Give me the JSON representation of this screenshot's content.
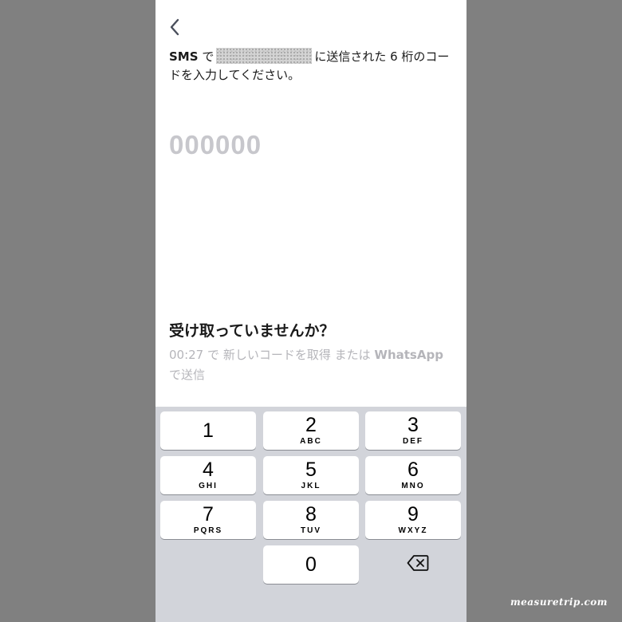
{
  "instruction": {
    "prefix": "SMS",
    "particle": "で",
    "phone_number": "",
    "suffix": "に送信された 6 桁のコードを入力してください。"
  },
  "code_input": {
    "value": "",
    "placeholder": "000000"
  },
  "help": {
    "heading": "受け取っていませんか？",
    "timer": "00:27",
    "timer_suffix": "で",
    "new_code_link": "新しいコードを取得",
    "or": "または",
    "whatsapp_link": "WhatsApp",
    "whatsapp_suffix": "で送信"
  },
  "keypad": {
    "keys": [
      {
        "num": "1",
        "letters": ""
      },
      {
        "num": "2",
        "letters": "ABC"
      },
      {
        "num": "3",
        "letters": "DEF"
      },
      {
        "num": "4",
        "letters": "GHI"
      },
      {
        "num": "5",
        "letters": "JKL"
      },
      {
        "num": "6",
        "letters": "MNO"
      },
      {
        "num": "7",
        "letters": "PQRS"
      },
      {
        "num": "8",
        "letters": "TUV"
      },
      {
        "num": "9",
        "letters": "WXYZ"
      },
      {
        "num": "0",
        "letters": ""
      }
    ],
    "delete_icon": "backspace-icon"
  },
  "watermark": "measuretrip.com",
  "colors": {
    "background": "#808080",
    "keypad": "#d2d4da",
    "placeholder": "#c7c7cc",
    "muted_text": "#b5b5ba"
  }
}
